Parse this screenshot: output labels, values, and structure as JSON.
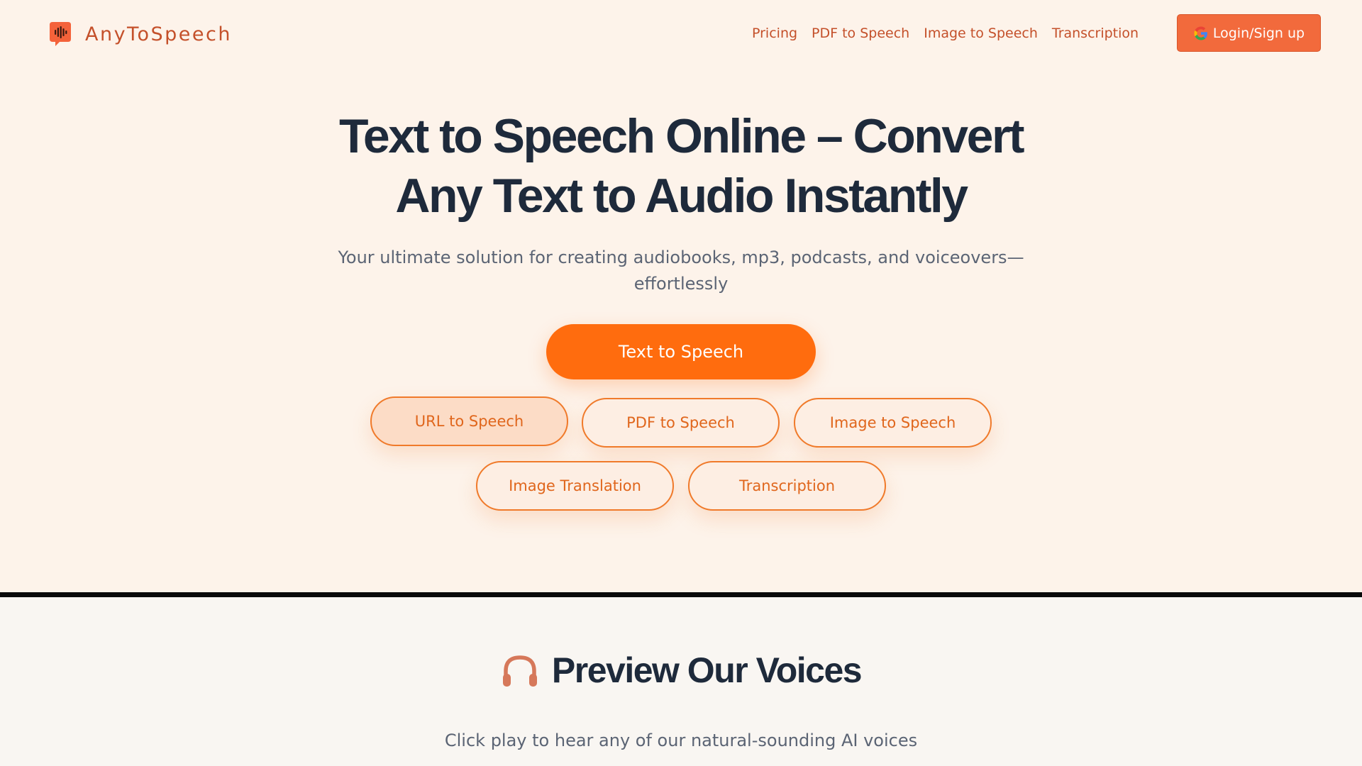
{
  "header": {
    "brand": "AnyToSpeech",
    "nav": [
      "Pricing",
      "PDF to Speech",
      "Image to Speech",
      "Transcription"
    ],
    "login_label": "Login/Sign up"
  },
  "hero": {
    "headline_line1": "Text to Speech Online – Convert",
    "headline_line2": "Any Text to Audio Instantly",
    "subtitle_line1": "Your ultimate solution for creating audiobooks, mp3, podcasts, and voiceovers—",
    "subtitle_line2": "effortlessly",
    "primary_button": "Text to Speech",
    "tools": [
      "URL to Speech",
      "PDF to Speech",
      "Image to Speech",
      "Image Translation",
      "Transcription"
    ]
  },
  "preview": {
    "title": "Preview Our Voices",
    "subtitle": "Click play to hear any of our natural-sounding AI voices"
  },
  "colors": {
    "brand": "#c4502a",
    "accent": "#ff6c0e",
    "login_bg": "#f26a3c",
    "heading": "#1e2a3b",
    "hero_bg": "#fdf3ea"
  },
  "icons": {
    "logo": "speech-bubble-waveform-icon",
    "login": "google-icon",
    "preview": "headphones-icon"
  }
}
